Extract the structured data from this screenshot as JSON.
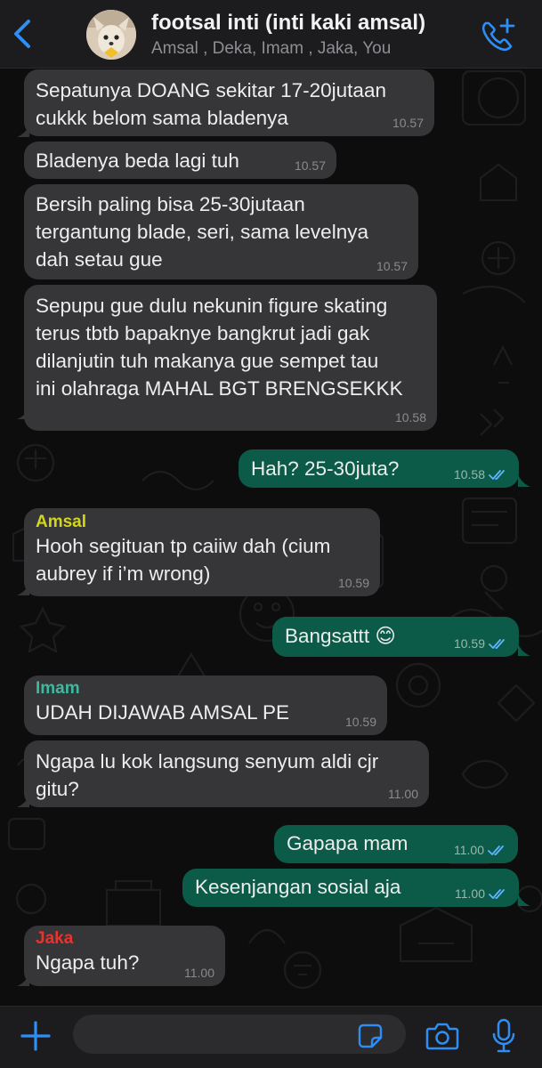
{
  "header": {
    "back_icon": "chevron-left-icon",
    "title": "footsal inti (inti kaki amsal)",
    "members": "Amsal , Deka, Imam , Jaka, You",
    "call_icon": "add-call-icon"
  },
  "messages": [
    {
      "direction": "in",
      "sender": "",
      "text": "Sepatunya DOANG sekitar 17-20jutaan\ncukkk belom sama bladenya",
      "time": "10.57"
    },
    {
      "direction": "in",
      "sender": "",
      "text": "Bladenya beda lagi tuh",
      "time": "10.57"
    },
    {
      "direction": "in",
      "sender": "",
      "text": "Bersih paling bisa 25-30jutaan\ntergantung blade, seri, sama levelnya\ndah setau gue",
      "time": "10.57"
    },
    {
      "direction": "in",
      "sender": "",
      "text": "Sepupu gue dulu nekunin figure skating\nterus tbtb bapaknye bangkrut jadi gak\ndilanjutin tuh makanya gue sempet tau\nini olahraga MAHAL BGT BRENGSEKKK",
      "time": "10.58"
    },
    {
      "direction": "out",
      "sender": "",
      "text": "Hah? 25-30juta?",
      "time": "10.58"
    },
    {
      "direction": "in",
      "sender": "Amsal",
      "text": "Hooh segituan tp caiiw dah (cium\naubrey if i’m wrong)",
      "time": "10.59"
    },
    {
      "direction": "out",
      "sender": "",
      "text": "Bangsattt 😊",
      "time": "10.59"
    },
    {
      "direction": "in",
      "sender": "Imam",
      "text": "UDAH DIJAWAB AMSAL PE",
      "time": "10.59"
    },
    {
      "direction": "in",
      "sender": "",
      "text": "Ngapa lu kok langsung senyum aldi cjr\ngitu?",
      "time": "11.00"
    },
    {
      "direction": "out",
      "sender": "",
      "text": "Gapapa mam",
      "time": "11.00"
    },
    {
      "direction": "out",
      "sender": "",
      "text": "Kesenjangan sosial aja",
      "time": "11.00"
    },
    {
      "direction": "in",
      "sender": "Jaka",
      "text": "Ngapa tuh?",
      "time": "11.00"
    }
  ],
  "sender_colors": {
    "Amsal": "#d4d51f",
    "Imam": "#3fb8a0",
    "Jaka": "#e8332f"
  },
  "colors": {
    "incoming_bubble": "#363638",
    "outgoing_bubble": "#0c5b48",
    "accent": "#2f8ef3",
    "read_ticks": "#5fb4ff"
  },
  "composer": {
    "value": "",
    "icons": [
      "plus-icon",
      "sticker-icon",
      "camera-icon",
      "microphone-icon"
    ]
  }
}
